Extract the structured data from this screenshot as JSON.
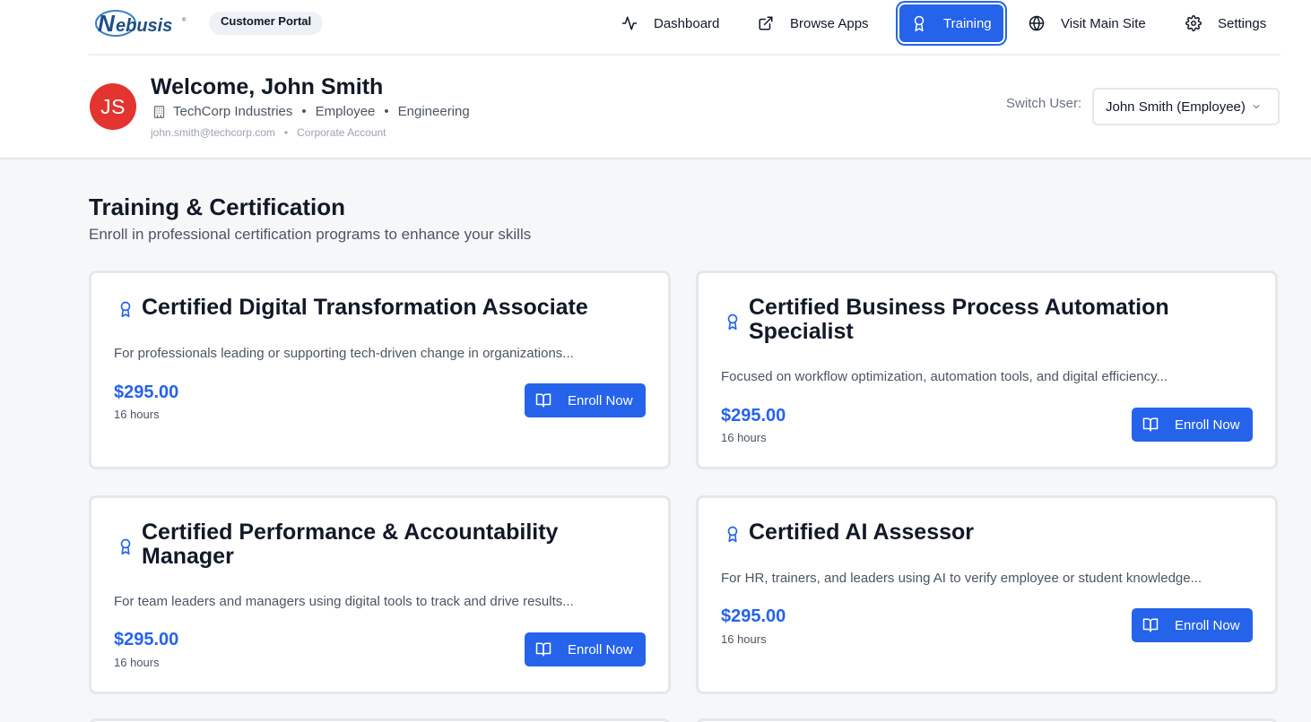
{
  "brand": {
    "logo_text": "Nebusis",
    "portal_badge": "Customer Portal"
  },
  "nav": {
    "items": [
      {
        "label": "Dashboard",
        "icon": "activity-icon"
      },
      {
        "label": "Browse Apps",
        "icon": "external-link-icon"
      },
      {
        "label": "Training",
        "icon": "award-icon",
        "active": true
      },
      {
        "label": "Visit Main Site",
        "icon": "globe-icon"
      },
      {
        "label": "Settings",
        "icon": "gear-icon"
      }
    ]
  },
  "user": {
    "initials": "JS",
    "welcome": "Welcome, John Smith",
    "company": "TechCorp Industries",
    "role": "Employee",
    "department": "Engineering",
    "email": "john.smith@techcorp.com",
    "account_type": "Corporate Account",
    "switch_label": "Switch User:",
    "switch_value": "John Smith (Employee)"
  },
  "page": {
    "title": "Training & Certification",
    "subtitle": "Enroll in professional certification programs to enhance your skills"
  },
  "courses": [
    {
      "title": "Certified Digital Transformation Associate",
      "description": "For professionals leading or supporting tech-driven change in organizations...",
      "price": "$295.00",
      "hours": "16 hours",
      "button": "Enroll Now"
    },
    {
      "title": "Certified Business Process Automation Specialist",
      "description": "Focused on workflow optimization, automation tools, and digital efficiency...",
      "price": "$295.00",
      "hours": "16 hours",
      "button": "Enroll Now"
    },
    {
      "title": "Certified Performance & Accountability Manager",
      "description": "For team leaders and managers using digital tools to track and drive results...",
      "price": "$295.00",
      "hours": "16 hours",
      "button": "Enroll Now"
    },
    {
      "title": "Certified AI Assessor",
      "description": "For HR, trainers, and leaders using AI to verify employee or student knowledge...",
      "price": "$295.00",
      "hours": "16 hours",
      "button": "Enroll Now"
    }
  ],
  "colors": {
    "accent": "#2563eb",
    "avatar": "#e3342f"
  }
}
